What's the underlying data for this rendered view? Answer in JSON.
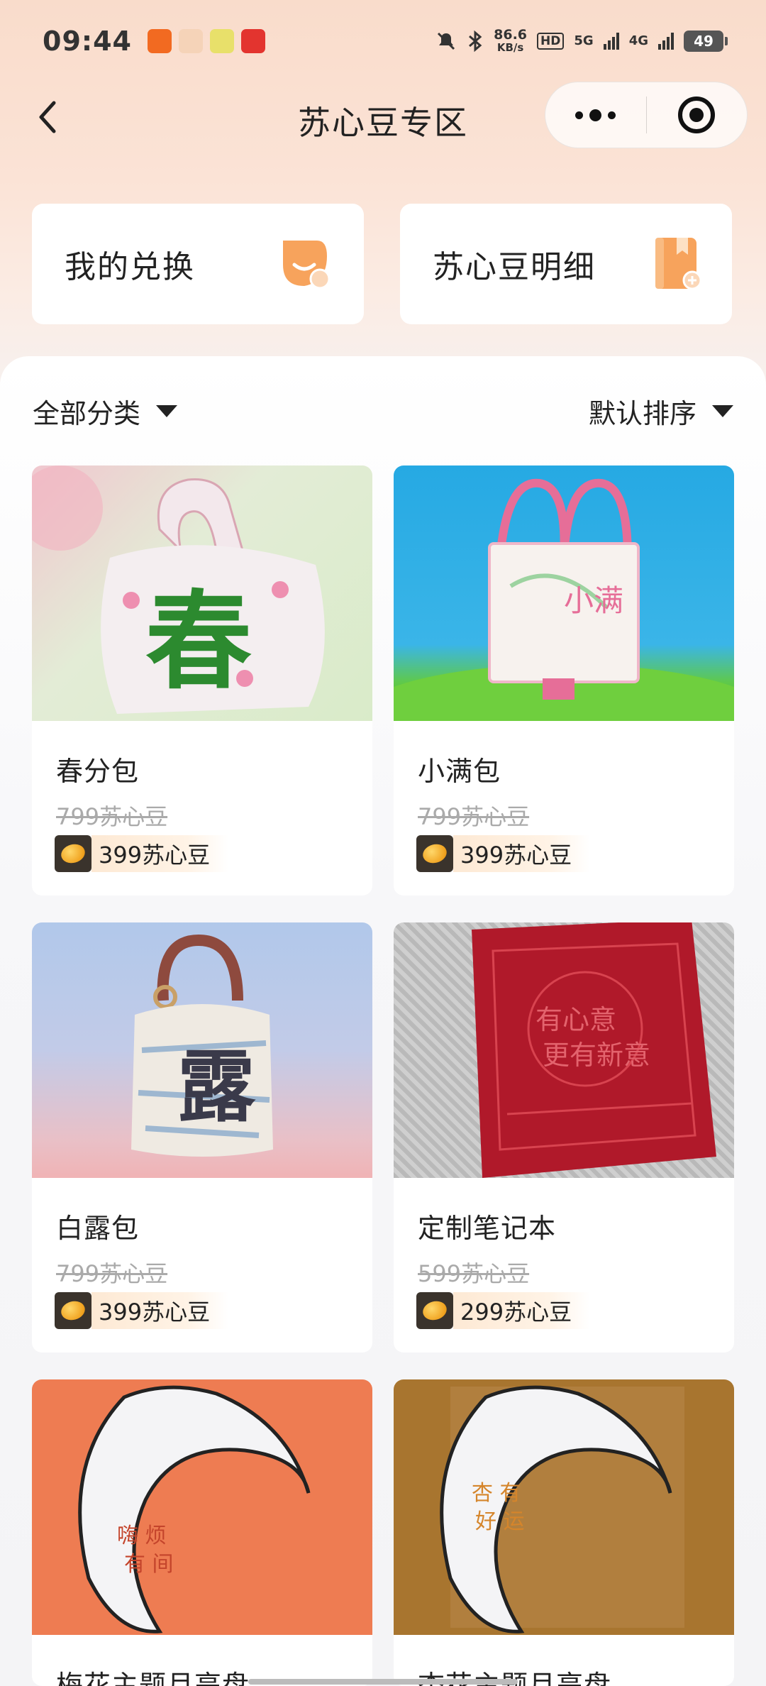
{
  "status_bar": {
    "time": "09:44",
    "net_speed_value": "86.6",
    "net_speed_unit": "KB/s",
    "hd_label": "HD",
    "sim1_label": "5G",
    "sim2_label": "4G",
    "battery": "49"
  },
  "nav": {
    "title": "苏心豆专区"
  },
  "quick_links": [
    {
      "label": "我的兑换",
      "icon": "chat-bubble-icon"
    },
    {
      "label": "苏心豆明细",
      "icon": "ledger-book-icon"
    }
  ],
  "filters": {
    "category": "全部分类",
    "sort": "默认排序"
  },
  "products": [
    {
      "name": "春分包",
      "original_price": "799苏心豆",
      "price": "399苏心豆",
      "image": "pink-knit-tote-bag",
      "image_bg": "#dfe9cf"
    },
    {
      "name": "小满包",
      "original_price": "799苏心豆",
      "price": "399苏心豆",
      "image": "transparent-tote-on-blue-sky",
      "image_bg": "#2fa8e0"
    },
    {
      "name": "白露包",
      "original_price": "799苏心豆",
      "price": "399苏心豆",
      "image": "printed-canvas-bucket-bag",
      "image_bg": "#b9c9e6"
    },
    {
      "name": "定制笔记本",
      "original_price": "599苏心豆",
      "price": "299苏心豆",
      "image": "red-embossed-notebook",
      "image_bg": "#bdbdbd"
    },
    {
      "name": "梅花主题月亮盘",
      "original_price": "",
      "price": "",
      "image": "crescent-moon-plate-orange",
      "image_bg": "#ee7c52"
    },
    {
      "name": "杏花主题月亮盘",
      "original_price": "",
      "price": "",
      "image": "crescent-moon-plate-brown",
      "image_bg": "#a8752f"
    }
  ],
  "colors": {
    "header_gradient_top": "#f9dccb",
    "price_pill": "#fde9d4",
    "coin_badge": "#3a332c",
    "accent_orange": "#f7a35c"
  }
}
